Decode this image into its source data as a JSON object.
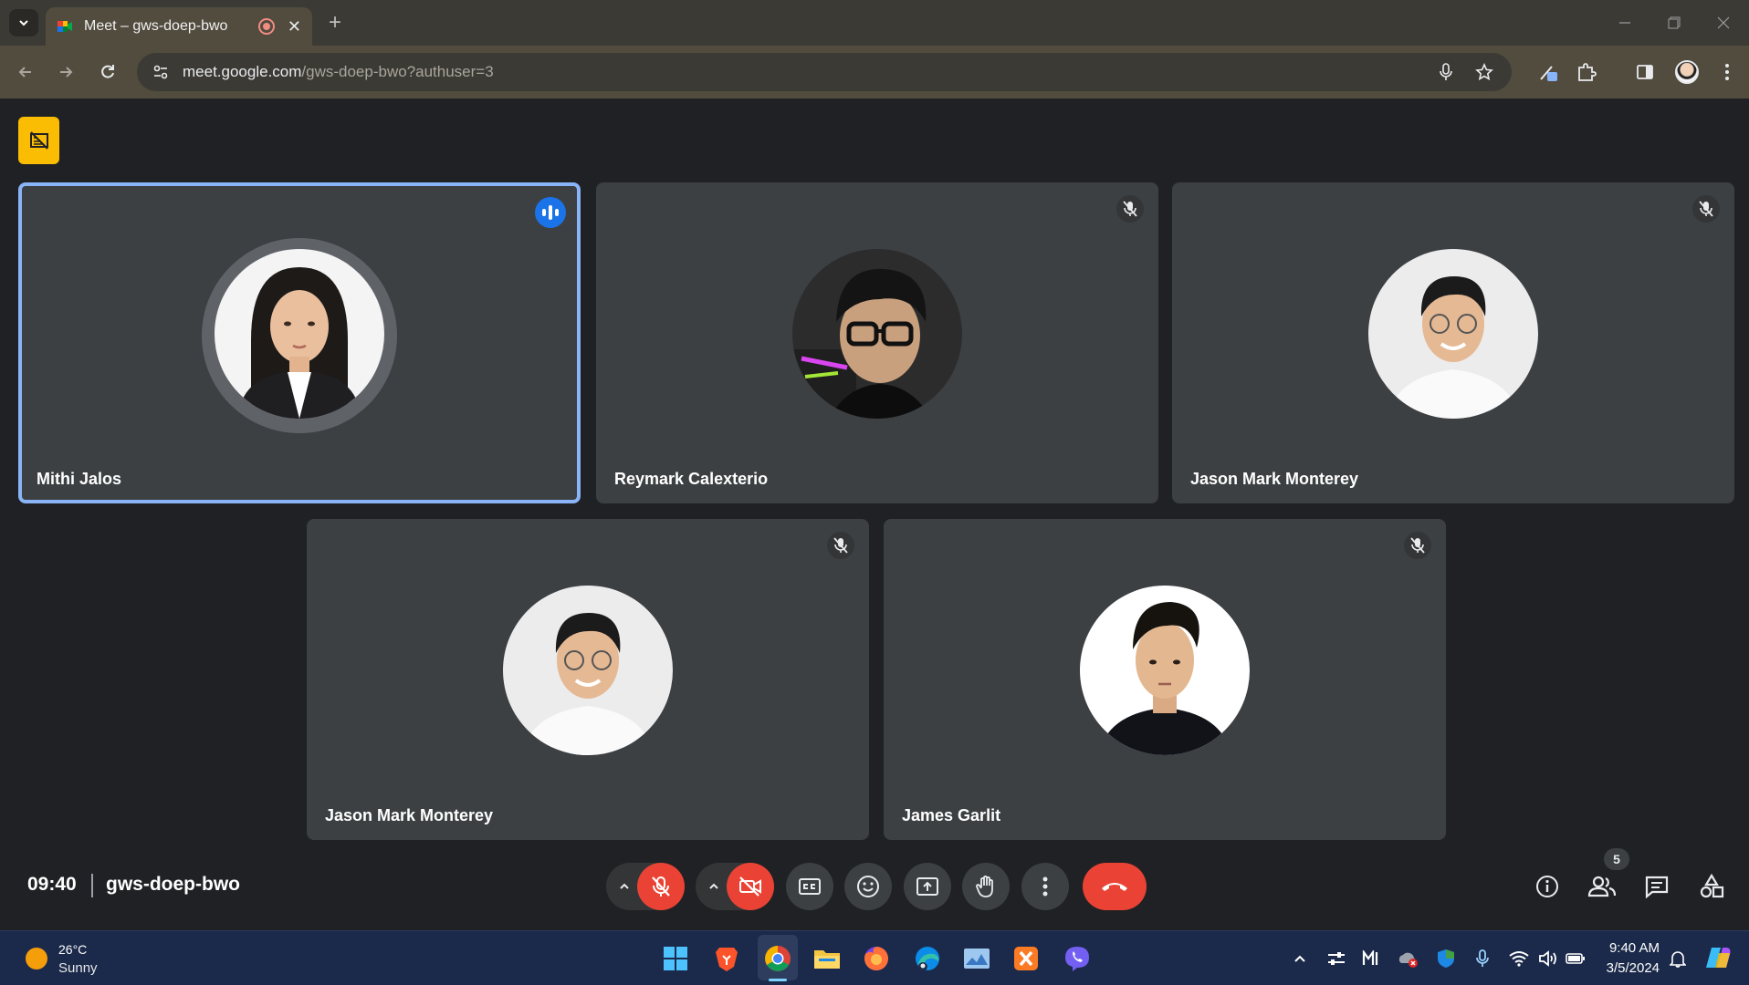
{
  "browser": {
    "tab_title": "Meet – gws-doep-bwo",
    "url_host": "meet.google.com",
    "url_path": "/gws-doep-bwo?authuser=3"
  },
  "meeting": {
    "time": "09:40",
    "code": "gws-doep-bwo",
    "participant_count": "5"
  },
  "participants": [
    {
      "name": "Mithi Jalos",
      "speaking": true,
      "muted": false
    },
    {
      "name": "Reymark Calexterio",
      "speaking": false,
      "muted": true
    },
    {
      "name": "Jason Mark Monterey",
      "speaking": false,
      "muted": true
    },
    {
      "name": "Jason Mark Monterey",
      "speaking": false,
      "muted": true
    },
    {
      "name": "James Garlit",
      "speaking": false,
      "muted": true
    }
  ],
  "controls": {
    "mic": "muted",
    "camera": "off"
  },
  "taskbar": {
    "weather_temp": "26°C",
    "weather_desc": "Sunny",
    "clock_time": "9:40 AM",
    "clock_date": "3/5/2024"
  },
  "colors": {
    "accent": "#8ab4f8",
    "danger": "#ea4335",
    "tile": "#3c4043",
    "background": "#202124"
  }
}
